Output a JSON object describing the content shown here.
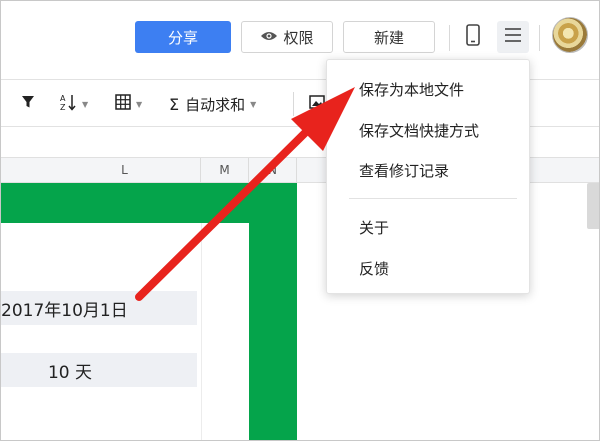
{
  "header": {
    "share_label": "分享",
    "permission_label": "权限",
    "new_label": "新建"
  },
  "toolbar": {
    "autosum_label": "自动求和"
  },
  "columns": [
    "L",
    "M",
    "N"
  ],
  "cells": {
    "date_value": "2017年10月1日",
    "days_value": "10 天"
  },
  "menu": {
    "items": [
      "保存为本地文件",
      "保存文档快捷方式",
      "查看修订记录",
      "关于",
      "反馈"
    ]
  },
  "colors": {
    "share_button": "#3d7ff2",
    "green_border": "#05a44b",
    "arrow": "#e8231d"
  },
  "icons": [
    "eye-icon",
    "phone-icon",
    "hamburger-menu-icon",
    "filter-icon",
    "sort-icon",
    "border-icon",
    "sigma-icon",
    "image-icon",
    "caret-down-icon"
  ]
}
